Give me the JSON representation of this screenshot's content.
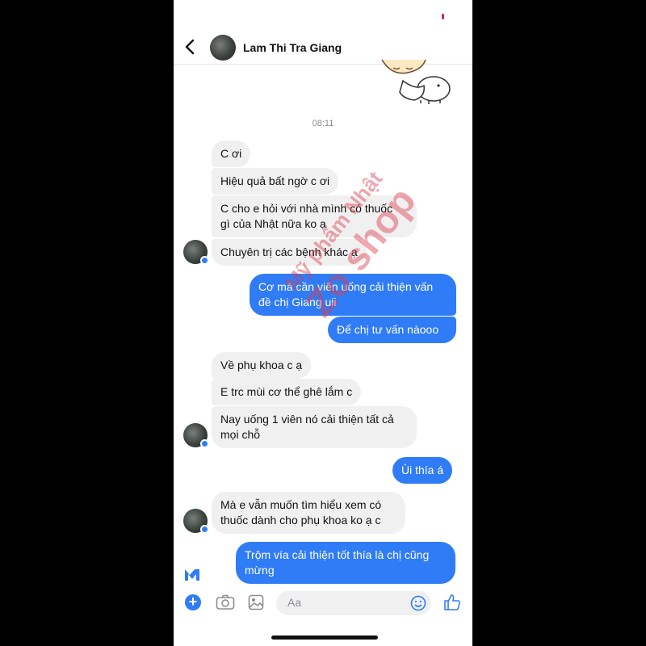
{
  "header": {
    "contact_name": "Lam Thi Tra Giang"
  },
  "timestamp": "08:11",
  "messages": [
    {
      "side": "in",
      "text": "C ơi"
    },
    {
      "side": "in",
      "text": "Hiệu quả bất ngờ c ơi"
    },
    {
      "side": "in",
      "text": "C cho e hỏi với nhà mình có thuốc\ngì của Nhật nữa ko ạ"
    },
    {
      "side": "in",
      "text": "Chuyên trị các bệnh khác ạ"
    },
    {
      "side": "out",
      "text": "Cơ mà cần viên uống cải thiện vấn\nđề chị Giang uii"
    },
    {
      "side": "out",
      "text": "Để chị tư vấn nàooo"
    },
    {
      "side": "in",
      "text": "Về phụ khoa c ạ"
    },
    {
      "side": "in",
      "text": "E trc mùi cơ thể ghê lắm c"
    },
    {
      "side": "in",
      "text": "Nay uống 1 viên nó cải thiện tất cả\nmọi chỗ"
    },
    {
      "side": "out",
      "text": "Ùi thía á"
    },
    {
      "side": "in",
      "text": "Mà e vẫn muốn tìm hiểu xem có\nthuốc dành cho phụ khoa ko ạ c"
    },
    {
      "side": "out",
      "text": "Trộm vía cải thiện tốt thía là chị cũng\nmừng"
    }
  ],
  "composer": {
    "placeholder": "Aa"
  },
  "watermark": {
    "line1": "Mỹ phẩm Nhật",
    "line2": "Zo shop"
  },
  "colors": {
    "accent": "#2f7cf6",
    "incoming_bubble": "#f0f0f0",
    "watermark": "#dc3c50"
  },
  "icons": [
    "back-arrow-icon",
    "plus-icon",
    "camera-icon",
    "image-icon",
    "emoji-icon",
    "like-icon",
    "messenger-icon"
  ]
}
